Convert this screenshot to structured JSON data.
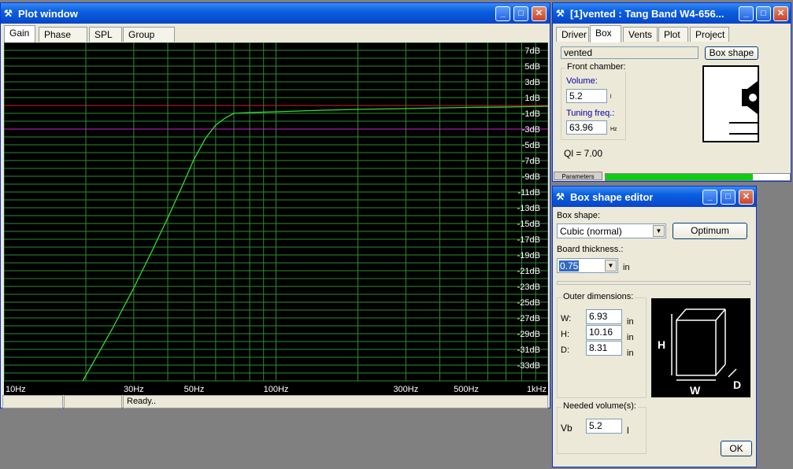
{
  "plot_window": {
    "title": "Plot window",
    "tabs": [
      "Gain",
      "Phase plot",
      "SPL",
      "Group delay"
    ],
    "active_tab": "Gain",
    "status": "Ready..",
    "colors": {
      "background": "#000000",
      "grid": "#2e8b2e",
      "curve": "#33dd33",
      "ref_red": "#cc2222",
      "ref_magenta": "#cc22cc",
      "label": "#ffffff"
    }
  },
  "chart_data": {
    "type": "line",
    "title": "",
    "xlabel": "",
    "ylabel": "",
    "x_scale": "log",
    "xlim": [
      10,
      1000
    ],
    "ylim": [
      -35,
      8
    ],
    "x_tick_labels": [
      {
        "label": "10Hz",
        "value": 10
      },
      {
        "label": "30Hz",
        "value": 30
      },
      {
        "label": "50Hz",
        "value": 50
      },
      {
        "label": "100Hz",
        "value": 100
      },
      {
        "label": "300Hz",
        "value": 300
      },
      {
        "label": "500Hz",
        "value": 500
      },
      {
        "label": "1kHz",
        "value": 1000
      }
    ],
    "y_tick_labels": [
      "7dB",
      "5dB",
      "3dB",
      "1dB",
      "-1dB",
      "-3dB",
      "-5dB",
      "-7dB",
      "-9dB",
      "-11dB",
      "-13dB",
      "-15dB",
      "-17dB",
      "-19dB",
      "-21dB",
      "-23dB",
      "-25dB",
      "-27dB",
      "-29dB",
      "-31dB",
      "-33dB"
    ],
    "y_tick_values": [
      7,
      5,
      3,
      1,
      -1,
      -3,
      -5,
      -7,
      -9,
      -11,
      -13,
      -15,
      -17,
      -19,
      -21,
      -23,
      -25,
      -27,
      -29,
      -31,
      -33
    ],
    "grid": true,
    "reference_lines": [
      {
        "y": 0,
        "color": "red"
      },
      {
        "y": -3,
        "color": "magenta"
      }
    ],
    "series": [
      {
        "x": [
          19.5,
          25,
          30,
          35,
          40,
          45,
          50,
          55,
          60,
          65,
          70,
          80,
          100,
          150,
          200,
          300,
          500,
          700,
          1000
        ],
        "y": [
          -35,
          -28.4,
          -23.2,
          -18.5,
          -14.3,
          -10.4,
          -6.8,
          -4.2,
          -2.5,
          -1.6,
          -1.0,
          -0.9,
          -0.8,
          -0.6,
          -0.5,
          -0.4,
          -0.25,
          -0.2,
          -0.1
        ]
      }
    ]
  },
  "vented_window": {
    "title": "[1]vented : Tang Band W4-656...",
    "tabs": [
      "Driver",
      "Box",
      "Vents",
      "Plot",
      "Project"
    ],
    "active_tab": "Box",
    "name_value": "vented",
    "box_shape_button": "Box shape",
    "front_chamber_label": "Front chamber:",
    "volume_label": "Volume:",
    "volume_value": "5.2",
    "volume_unit": "l",
    "tuning_label": "Tuning freq.:",
    "tuning_value": "63.96",
    "tuning_unit": "Hz",
    "ql": "Ql = 7.00",
    "parameters_tab": "Parameters",
    "progress_fraction": 0.8
  },
  "box_editor": {
    "title": "Box shape editor",
    "box_shape_label": "Box shape:",
    "box_shape_value": "Cubic (normal)",
    "optimum_button": "Optimum",
    "board_thickness_label": "Board thickness.:",
    "board_thickness_value": "0.75",
    "board_unit": "in",
    "outer_dimensions_label": "Outer dimensions:",
    "dims": [
      {
        "label": "W:",
        "value": "6.93",
        "unit": "in"
      },
      {
        "label": "H:",
        "value": "10.16",
        "unit": "in"
      },
      {
        "label": "D:",
        "value": "8.31",
        "unit": "in"
      }
    ],
    "needed_volume_label": "Needed volume(s):",
    "vb_label": "Vb",
    "vb_value": "5.2",
    "vb_unit": "l",
    "ok_button": "OK",
    "cube_labels": {
      "h": "H",
      "w": "W",
      "d": "D"
    }
  }
}
